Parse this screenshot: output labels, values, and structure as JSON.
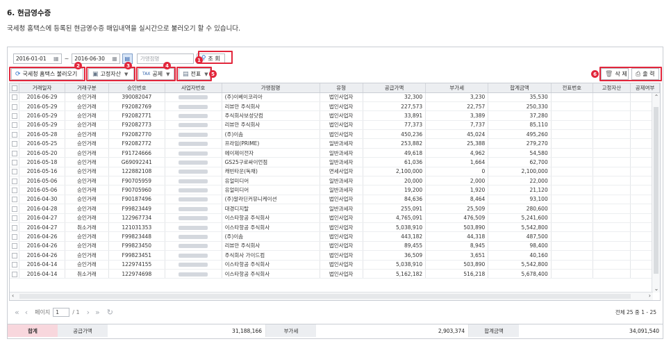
{
  "heading": "6. 현금영수증",
  "description": "국세청 홈택스에 등록된 현금영수증 매입내역을 실시간으로 불러오기 할 수 있습니다.",
  "search": {
    "date_from": "2016-01-01",
    "date_to": "2016-06-30",
    "tilde": "~",
    "merchant_placeholder": "가맹점명",
    "query_label": "조 회"
  },
  "toolbar": {
    "import_label": "국세청 홈택스 불러오기",
    "fixed_asset_label": "고정자산",
    "deduction_label": "공제",
    "tax_badge": "TAX",
    "voucher_label": "전표",
    "delete_label": "삭 제",
    "print_label": "출 력"
  },
  "callouts": [
    "1",
    "2",
    "3",
    "4",
    "5",
    "6"
  ],
  "columns": [
    "거래일자",
    "거래구분",
    "승인번호",
    "사업자번호",
    "가맹점명",
    "유형",
    "공급가액",
    "부가세",
    "합계금액",
    "전표번호",
    "고정자산",
    "공제여부"
  ],
  "rows": [
    [
      "2016-06-29",
      "승인거래",
      "390082047",
      "(주)이베이코리아",
      "법인사업자",
      "32,300",
      "3,230",
      "35,530"
    ],
    [
      "2016-05-29",
      "승인거래",
      "F92082769",
      "리뷰안 주식회사",
      "법인사업자",
      "227,573",
      "22,757",
      "250,330"
    ],
    [
      "2016-05-29",
      "승인거래",
      "F92082771",
      "주식회사보성닷컴",
      "법인사업자",
      "33,891",
      "3,389",
      "37,280"
    ],
    [
      "2016-05-29",
      "승인거래",
      "F92082773",
      "리뷰안 주식회사",
      "법인사업자",
      "77,373",
      "7,737",
      "85,110"
    ],
    [
      "2016-05-28",
      "승인거래",
      "F92082770",
      "(주)이솜",
      "법인사업자",
      "450,236",
      "45,024",
      "495,260"
    ],
    [
      "2016-05-25",
      "승인거래",
      "F92082772",
      "프라임(PRIME)",
      "일반과세자",
      "253,882",
      "25,388",
      "279,270"
    ],
    [
      "2016-05-20",
      "승인거래",
      "F91724666",
      "에이제이전자",
      "일반과세자",
      "49,618",
      "4,962",
      "54,580"
    ],
    [
      "2016-05-18",
      "승인거래",
      "G69092241",
      "GS25구로싸이언점",
      "일반과세자",
      "61,036",
      "1,664",
      "62,700"
    ],
    [
      "2016-05-16",
      "승인거래",
      "122882108",
      "캐빈타운(독채)",
      "면세사업자",
      "2,100,000",
      "0",
      "2,100,000"
    ],
    [
      "2016-05-06",
      "승인거래",
      "F90705959",
      "유얼미디어",
      "일반과세자",
      "20,000",
      "2,000",
      "22,000"
    ],
    [
      "2016-05-06",
      "승인거래",
      "F90705960",
      "유얼미디어",
      "일반과세자",
      "19,200",
      "1,920",
      "21,120"
    ],
    [
      "2016-04-30",
      "승인거래",
      "F90187496",
      "(주)알라딘커뮤니케이션",
      "법인사업자",
      "84,636",
      "8,464",
      "93,100"
    ],
    [
      "2016-04-28",
      "승인거래",
      "F99823449",
      "대경디지탈",
      "일반과세자",
      "255,091",
      "25,509",
      "280,600"
    ],
    [
      "2016-04-27",
      "승인거래",
      "122967734",
      "이스타항공 주식회사",
      "법인사업자",
      "4,765,091",
      "476,509",
      "5,241,600"
    ],
    [
      "2016-04-27",
      "취소거래",
      "121031353",
      "이스타항공 주식회사",
      "법인사업자",
      "5,038,910",
      "503,890",
      "5,542,800"
    ],
    [
      "2016-04-26",
      "승인거래",
      "F99823448",
      "(주)이솜",
      "법인사업자",
      "443,182",
      "44,318",
      "487,500"
    ],
    [
      "2016-04-26",
      "승인거래",
      "F99823450",
      "리뷰안 주식회사",
      "법인사업자",
      "89,455",
      "8,945",
      "98,400"
    ],
    [
      "2016-04-26",
      "승인거래",
      "F99823451",
      "주식회사 가이드컴",
      "법인사업자",
      "36,509",
      "3,651",
      "40,160"
    ],
    [
      "2016-04-14",
      "승인거래",
      "122974155",
      "이스타항공 주식회사",
      "법인사업자",
      "5,038,910",
      "503,890",
      "5,542,800"
    ],
    [
      "2016-04-14",
      "취소거래",
      "122974698",
      "이스타항공 주식회사",
      "법인사업자",
      "5,162,182",
      "516,218",
      "5,678,400"
    ]
  ],
  "pager": {
    "page_label": "페이지",
    "current_page": "1",
    "total_pages": "/ 1",
    "summary": "전체 25 중 1 - 25"
  },
  "totals": {
    "label": "합계",
    "supply_key": "공급가액",
    "supply_value": "31,188,166",
    "vat_key": "부가세",
    "vat_value": "2,903,374",
    "total_key": "합계금액",
    "total_value": "34,091,540"
  },
  "colors": {
    "accent_red": "#e2263b",
    "header_bg": "#eceef1",
    "total_label_bg": "#f8d7dd"
  },
  "icons": [
    "calendar-icon",
    "search-icon",
    "refresh-icon",
    "fixed-asset-icon",
    "tax-icon",
    "voucher-icon",
    "trash-icon",
    "print-icon",
    "chevron-down-icon",
    "first-page-icon",
    "prev-page-icon",
    "next-page-icon",
    "last-page-icon",
    "reload-icon"
  ]
}
